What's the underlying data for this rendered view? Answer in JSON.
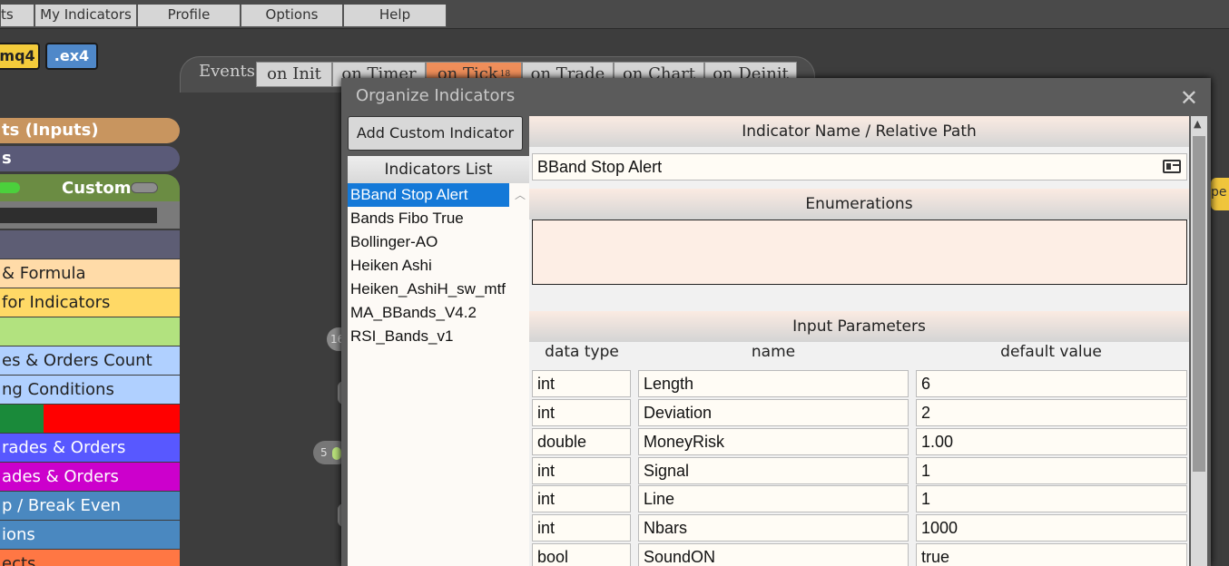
{
  "menu": [
    "ts",
    "My Indicators",
    "Profile",
    "Options",
    "Help"
  ],
  "files": {
    "mq4": ".mq4",
    "ex4": ".ex4"
  },
  "events": {
    "label": "Events",
    "tabs": [
      "on Init",
      "on Timer",
      "on Tick",
      "on Trade",
      "on Chart",
      "on Deinit"
    ],
    "active_tab": "on Tick",
    "tick_badge": "18"
  },
  "sidebar": [
    {
      "label": "ts (Inputs)",
      "color": "#c8955f"
    },
    {
      "label": "s",
      "color": "#5a5a78"
    },
    {
      "label": "Custom",
      "color": "#6b8c43"
    },
    {
      "label": "",
      "color": "#7a7a7a"
    },
    {
      "label": "",
      "color": "#5d5d74"
    },
    {
      "label": "& Formula",
      "color": "#ffdba8"
    },
    {
      "label": "for Indicators",
      "color": "#ffd966"
    },
    {
      "label": "",
      "color": "#b2e27f"
    },
    {
      "label": "es & Orders Count",
      "color": "#b0d0ff"
    },
    {
      "label": "ng Conditions",
      "color": "#b0d0ff"
    },
    {
      "label": "",
      "color": "#ff0000"
    },
    {
      "label": "rades & Orders",
      "color": "#5858ff"
    },
    {
      "label": "ades & Orders",
      "color": "#cc00cc"
    },
    {
      "label": "p / Break Even",
      "color": "#4a88c0"
    },
    {
      "label": "ions",
      "color": "#4a88c0"
    },
    {
      "label": "ects",
      "color": "#ff7744"
    }
  ],
  "canvas_nodes": [
    "16",
    "5"
  ],
  "peek_text": "pe",
  "modal": {
    "title": "Organize Indicators",
    "close": "✕",
    "add_button": "Add Custom Indicator",
    "list_header": "Indicators List",
    "indicators": [
      "BBand Stop Alert",
      "Bands Fibo True",
      "Bollinger-AO",
      "Heiken Ashi",
      "Heiken_AshiH_sw_mtf",
      "MA_BBands_V4.2",
      "RSI_Bands_v1"
    ],
    "selected_indicator": "BBand Stop Alert",
    "name_header": "Indicator Name / Relative Path",
    "name_value": "BBand Stop Alert",
    "enum_header": "Enumerations",
    "enum_value": "",
    "params_header": "Input Parameters",
    "columns": [
      "data type",
      "name",
      "default value"
    ],
    "params": [
      {
        "type": "int",
        "name": "Length",
        "value": "6"
      },
      {
        "type": "int",
        "name": "Deviation",
        "value": "2"
      },
      {
        "type": "double",
        "name": "MoneyRisk",
        "value": "1.00"
      },
      {
        "type": "int",
        "name": "Signal",
        "value": "1"
      },
      {
        "type": "int",
        "name": "Line",
        "value": "1"
      },
      {
        "type": "int",
        "name": "Nbars",
        "value": "1000"
      },
      {
        "type": "bool",
        "name": "SoundON",
        "value": "true"
      }
    ]
  }
}
